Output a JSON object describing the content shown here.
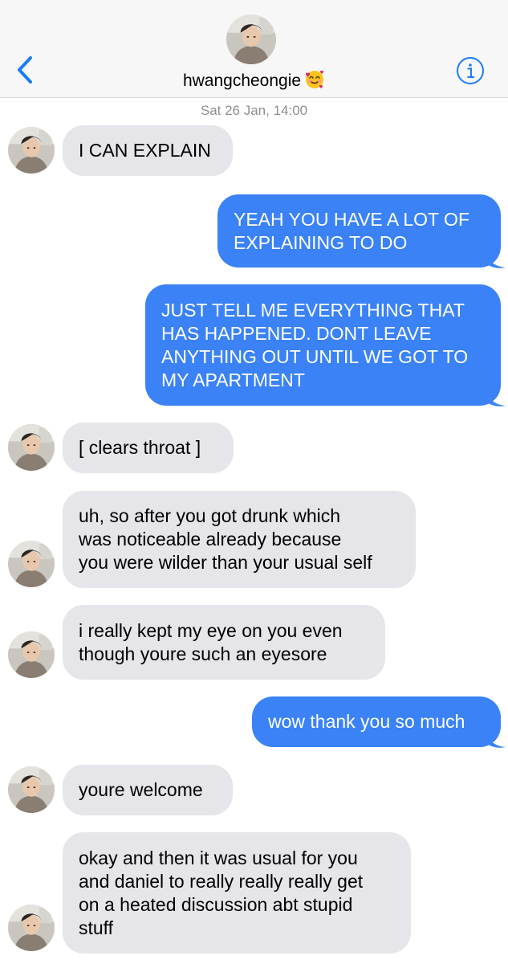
{
  "header": {
    "back_icon": "chevron-left-icon",
    "contact_name": "hwangcheongie",
    "contact_emoji": "smiling-face-with-hearts",
    "info_icon": "info-icon"
  },
  "thread": {
    "timestamp": "Sat 26 Jan, 14:00",
    "messages": [
      {
        "from": "them",
        "text": "I CAN EXPLAIN"
      },
      {
        "from": "me",
        "text": "YEAH YOU HAVE A LOT OF\nEXPLAINING TO DO"
      },
      {
        "from": "me",
        "text": "JUST TELL ME EVERYTHING THAT\nHAS HAPPENED. DONT LEAVE\nANYTHING OUT UNTIL WE GOT TO\nMY APARTMENT"
      },
      {
        "from": "them",
        "text": "[ clears throat ]"
      },
      {
        "from": "them",
        "text": "uh, so after you got drunk which\nwas noticeable already because\nyou were wilder than your usual self"
      },
      {
        "from": "them",
        "text": "i really kept my eye on you even\nthough youre such an eyesore"
      },
      {
        "from": "me",
        "text": "wow thank you so much"
      },
      {
        "from": "them",
        "text": "youre welcome"
      },
      {
        "from": "them",
        "text": "okay and then it was usual for you\nand daniel to really really really get\non a heated discussion abt stupid\nstuff"
      }
    ]
  },
  "colors": {
    "sent_bubble": "#3a82f6",
    "received_bubble": "#e5e5ea",
    "accent": "#1a7cf5"
  }
}
